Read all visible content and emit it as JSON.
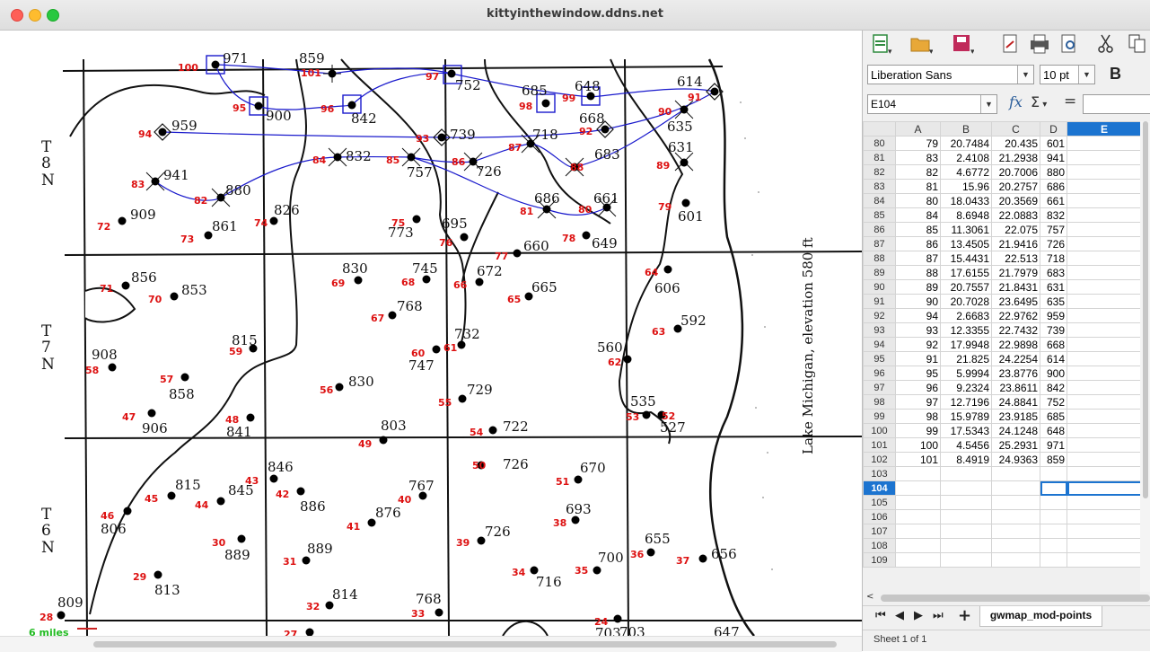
{
  "window": {
    "title": "kittyinthewindow.ddns.net"
  },
  "map": {
    "township_labels": [
      [
        "T",
        "8",
        "N"
      ],
      [
        "T",
        "7",
        "N"
      ],
      [
        "T",
        "6",
        "N"
      ]
    ],
    "lake_label": "Lake Michigan, elevation 580 ft",
    "scale_label": "6 miles",
    "points": [
      [
        "28",
        "809"
      ],
      [
        "29",
        "813"
      ],
      [
        "30",
        "889"
      ],
      [
        "31",
        "889"
      ],
      [
        "32",
        "814"
      ],
      [
        "33",
        "768"
      ],
      [
        "34",
        "716"
      ],
      [
        "35",
        "700"
      ],
      [
        "36",
        "655"
      ],
      [
        "37",
        "656"
      ],
      [
        "38",
        "693"
      ],
      [
        "39",
        "726"
      ],
      [
        "40",
        "767"
      ],
      [
        "41",
        "876"
      ],
      [
        "42",
        "886"
      ],
      [
        "43",
        "846"
      ],
      [
        "44",
        "845"
      ],
      [
        "45",
        "815"
      ],
      [
        "46",
        "806"
      ],
      [
        "47",
        "906"
      ],
      [
        "48",
        "841"
      ],
      [
        "49",
        "803"
      ],
      [
        "50",
        "726"
      ],
      [
        "51",
        "670"
      ],
      [
        "52",
        "527"
      ],
      [
        "53",
        "535"
      ],
      [
        "54",
        "722"
      ],
      [
        "55",
        "729"
      ],
      [
        "56",
        "830"
      ],
      [
        "57",
        "858"
      ],
      [
        "58",
        "908"
      ],
      [
        "59",
        "815"
      ],
      [
        "60",
        "747"
      ],
      [
        "61",
        "732"
      ],
      [
        "62",
        "560"
      ],
      [
        "63",
        "592"
      ],
      [
        "64",
        "606"
      ],
      [
        "65",
        "665"
      ],
      [
        "66",
        "672"
      ],
      [
        "67",
        "768"
      ],
      [
        "68",
        "745"
      ],
      [
        "69",
        "830"
      ],
      [
        "70",
        "853"
      ],
      [
        "71",
        "856"
      ],
      [
        "72",
        "909"
      ],
      [
        "73",
        "861"
      ],
      [
        "74",
        "826"
      ],
      [
        "75",
        "773"
      ],
      [
        "76",
        "695"
      ],
      [
        "77",
        "660"
      ],
      [
        "78",
        "649"
      ],
      [
        "79",
        "601"
      ],
      [
        "80",
        "661"
      ],
      [
        "81",
        "686"
      ],
      [
        "82",
        "880"
      ],
      [
        "83",
        "941"
      ],
      [
        "84",
        "832"
      ],
      [
        "85",
        "757"
      ],
      [
        "86",
        "726"
      ],
      [
        "87",
        "718"
      ],
      [
        "88",
        "683"
      ],
      [
        "89",
        "631"
      ],
      [
        "90",
        "635"
      ],
      [
        "91",
        "614"
      ],
      [
        "92",
        "668"
      ],
      [
        "93",
        "739"
      ],
      [
        "94",
        "959"
      ],
      [
        "95",
        "900"
      ],
      [
        "96",
        "842"
      ],
      [
        "97",
        "752"
      ],
      [
        "98",
        "685"
      ],
      [
        "99",
        "648"
      ],
      [
        "100",
        "971"
      ],
      [
        "101",
        "859"
      ],
      [
        "24",
        "703"
      ],
      [
        "27",
        ""
      ],
      [
        "",
        "647"
      ],
      [
        "",
        "703"
      ]
    ]
  },
  "toolbar": {
    "font_name": "Liberation Sans",
    "font_size": "10 pt",
    "bold": "B"
  },
  "formula_bar": {
    "cell_ref": "E104",
    "fx": "fx",
    "sigma": "Σ",
    "equals": "="
  },
  "sheet": {
    "columns": [
      "A",
      "B",
      "C",
      "D",
      "E"
    ],
    "rows": [
      [
        "80",
        "79",
        "20.7484",
        "20.435",
        "601"
      ],
      [
        "81",
        "83",
        "2.4108",
        "21.2938",
        "941"
      ],
      [
        "82",
        "82",
        "4.6772",
        "20.7006",
        "880"
      ],
      [
        "83",
        "81",
        "15.96",
        "20.2757",
        "686"
      ],
      [
        "84",
        "80",
        "18.0433",
        "20.3569",
        "661"
      ],
      [
        "85",
        "84",
        "8.6948",
        "22.0883",
        "832"
      ],
      [
        "86",
        "85",
        "11.3061",
        "22.075",
        "757"
      ],
      [
        "87",
        "86",
        "13.4505",
        "21.9416",
        "726"
      ],
      [
        "88",
        "87",
        "15.4431",
        "22.513",
        "718"
      ],
      [
        "89",
        "88",
        "17.6155",
        "21.7979",
        "683"
      ],
      [
        "90",
        "89",
        "20.7557",
        "21.8431",
        "631"
      ],
      [
        "91",
        "90",
        "20.7028",
        "23.6495",
        "635"
      ],
      [
        "92",
        "94",
        "2.6683",
        "22.9762",
        "959"
      ],
      [
        "93",
        "93",
        "12.3355",
        "22.7432",
        "739"
      ],
      [
        "94",
        "92",
        "17.9948",
        "22.9898",
        "668"
      ],
      [
        "95",
        "91",
        "21.825",
        "24.2254",
        "614"
      ],
      [
        "96",
        "95",
        "5.9994",
        "23.8776",
        "900"
      ],
      [
        "97",
        "96",
        "9.2324",
        "23.8611",
        "842"
      ],
      [
        "98",
        "97",
        "12.7196",
        "24.8841",
        "752"
      ],
      [
        "99",
        "98",
        "15.9789",
        "23.9185",
        "685"
      ],
      [
        "100",
        "99",
        "17.5343",
        "24.1248",
        "648"
      ],
      [
        "101",
        "100",
        "4.5456",
        "25.2931",
        "971"
      ],
      [
        "102",
        "101",
        "8.4919",
        "24.9363",
        "859"
      ],
      [
        "103",
        "",
        "",
        "",
        ""
      ],
      [
        "104",
        "",
        "",
        "",
        ""
      ],
      [
        "105",
        "",
        "",
        "",
        ""
      ],
      [
        "106",
        "",
        "",
        "",
        ""
      ],
      [
        "107",
        "",
        "",
        "",
        ""
      ],
      [
        "108",
        "",
        "",
        "",
        ""
      ],
      [
        "109",
        "",
        "",
        "",
        ""
      ]
    ],
    "selected_column": "E",
    "selected_row": "104",
    "tab_name": "gwmap_mod-points",
    "status": "Sheet 1 of 1"
  }
}
